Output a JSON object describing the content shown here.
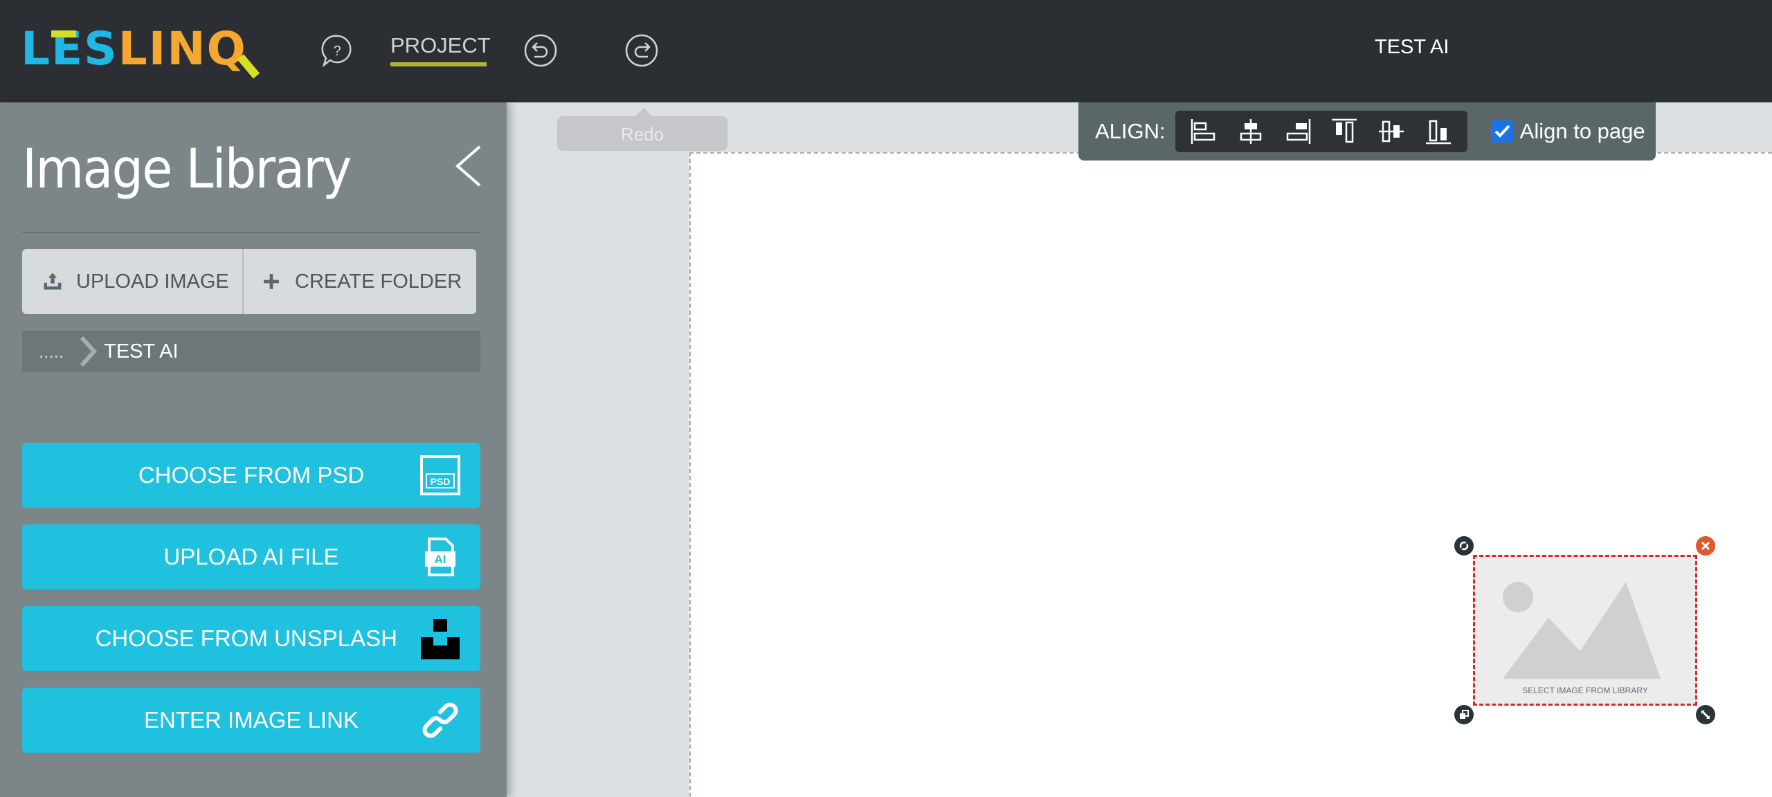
{
  "header": {
    "logo": {
      "part1": "L",
      "part2": "E",
      "part3": "S",
      "part4": "LIN",
      "part5": "Q"
    },
    "help_icon": "help-chat-icon",
    "project_tab": "PROJECT",
    "undo_icon": "undo-icon",
    "redo_icon": "redo-icon",
    "document_title": "TEST AI"
  },
  "tooltip": {
    "text": "Redo"
  },
  "sidebar": {
    "title": "Image Library",
    "actions": {
      "upload": "UPLOAD IMAGE",
      "create_folder": "CREATE FOLDER"
    },
    "breadcrumb": {
      "ellipsis": ".....",
      "current": "TEST AI"
    },
    "sources": [
      {
        "label": "CHOOSE FROM PSD",
        "icon": "psd-file-icon"
      },
      {
        "label": "UPLOAD AI FILE",
        "icon": "ai-file-icon"
      },
      {
        "label": "CHOOSE FROM UNSPLASH",
        "icon": "unsplash-icon"
      },
      {
        "label": "ENTER IMAGE LINK",
        "icon": "link-icon"
      }
    ]
  },
  "align_toolbar": {
    "label": "ALIGN:",
    "buttons": [
      "align-left",
      "align-center-horizontal",
      "align-right",
      "align-top",
      "align-middle-vertical",
      "align-bottom"
    ],
    "align_to_page": {
      "label": "Align to page",
      "checked": true
    }
  },
  "canvas": {
    "image_placeholder": {
      "caption": "SELECT IMAGE FROM LIBRARY"
    }
  },
  "colors": {
    "topbar": "#2b2f33",
    "sidebar": "#7c8688",
    "accent_cyan": "#1fc1de",
    "project_underline": "#b3b23a",
    "selection_border": "#d9262b",
    "close_handle": "#e0582b",
    "logo_blue": "#1fb7e3",
    "logo_orange": "#f5a830",
    "logo_yellow": "#d7df23"
  }
}
